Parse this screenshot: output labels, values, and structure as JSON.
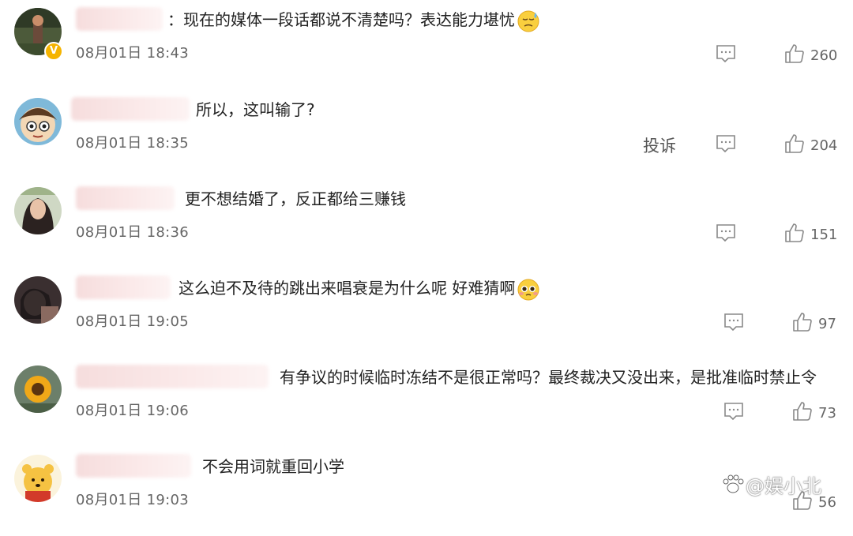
{
  "comments": [
    {
      "text": "：现在的媒体一段话都说不清楚吗？表达能力堪忧",
      "time": "08月01日 18:43",
      "likes": "260",
      "emoji": "sweat-face"
    },
    {
      "text": "所以，这叫输了?",
      "time": "08月01日 18:35",
      "likes": "204",
      "report": "投诉"
    },
    {
      "text": "更不想结婚了，反正都给三赚钱",
      "time": "08月01日 18:36",
      "likes": "151"
    },
    {
      "text": "这么迫不及待的跳出来唱衰是为什么呢 好难猜啊",
      "time": "08月01日 19:05",
      "likes": "97",
      "emoji": "pleading-face"
    },
    {
      "text": "有争议的时候临时冻结不是很正常吗？最终裁决又没出来，是批准临时禁止令",
      "time": "08月01日 19:06",
      "likes": "73"
    },
    {
      "text": "不会用词就重回小学",
      "time": "08月01日 19:03",
      "likes": "56"
    }
  ],
  "watermark": "@娱小北",
  "colors": {
    "badge": "#f5b400",
    "icon": "#888888"
  }
}
